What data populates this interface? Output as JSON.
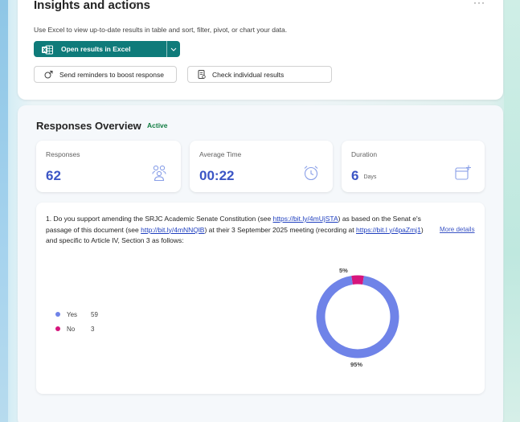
{
  "insights": {
    "title": "Insights and actions",
    "collapse_icon": "chevron-up-icon",
    "more_icon": "more-dots-icon",
    "description": "Use Excel to view up-to-date results in table and sort, filter, pivot, or chart your data.",
    "open_excel_label": "Open results in Excel",
    "send_reminders_label": "Send reminders to boost response",
    "check_results_label": "Check individual results"
  },
  "overview": {
    "title": "Responses Overview",
    "status": "Active",
    "stats": [
      {
        "label": "Responses",
        "value": "62",
        "icon": "people-icon"
      },
      {
        "label": "Average Time",
        "value": "00:22",
        "icon": "clock-icon"
      },
      {
        "label": "Duration",
        "value": "6",
        "unit": "Days",
        "icon": "calendar-add-icon"
      }
    ]
  },
  "question": {
    "text_1": "1. Do you support amending the SRJC Academic Senate Constitution (see ",
    "link_1": "https://bit.ly/4mUjSTA",
    "text_2": ") as based on the Senat e's passage of this document (see ",
    "link_2": "http://bit.ly/4mNNQlB",
    "text_3": ") at their 3 September 2025 meeting (recording at ",
    "link_3": "https://bit.l y/4paZmj1",
    "text_4": ") and specific to Article IV, Section 3 as follows:",
    "more_details": "More details"
  },
  "colors": {
    "accent": "#0f7b7a",
    "yes": "#6f83e8",
    "no": "#d6157c",
    "value_blue": "#3b55c5"
  },
  "chart_data": {
    "type": "pie",
    "variant": "donut",
    "categories": [
      "Yes",
      "No"
    ],
    "values": [
      59,
      3
    ],
    "percent_labels": [
      "95%",
      "5%"
    ],
    "legend_placement": "left"
  }
}
